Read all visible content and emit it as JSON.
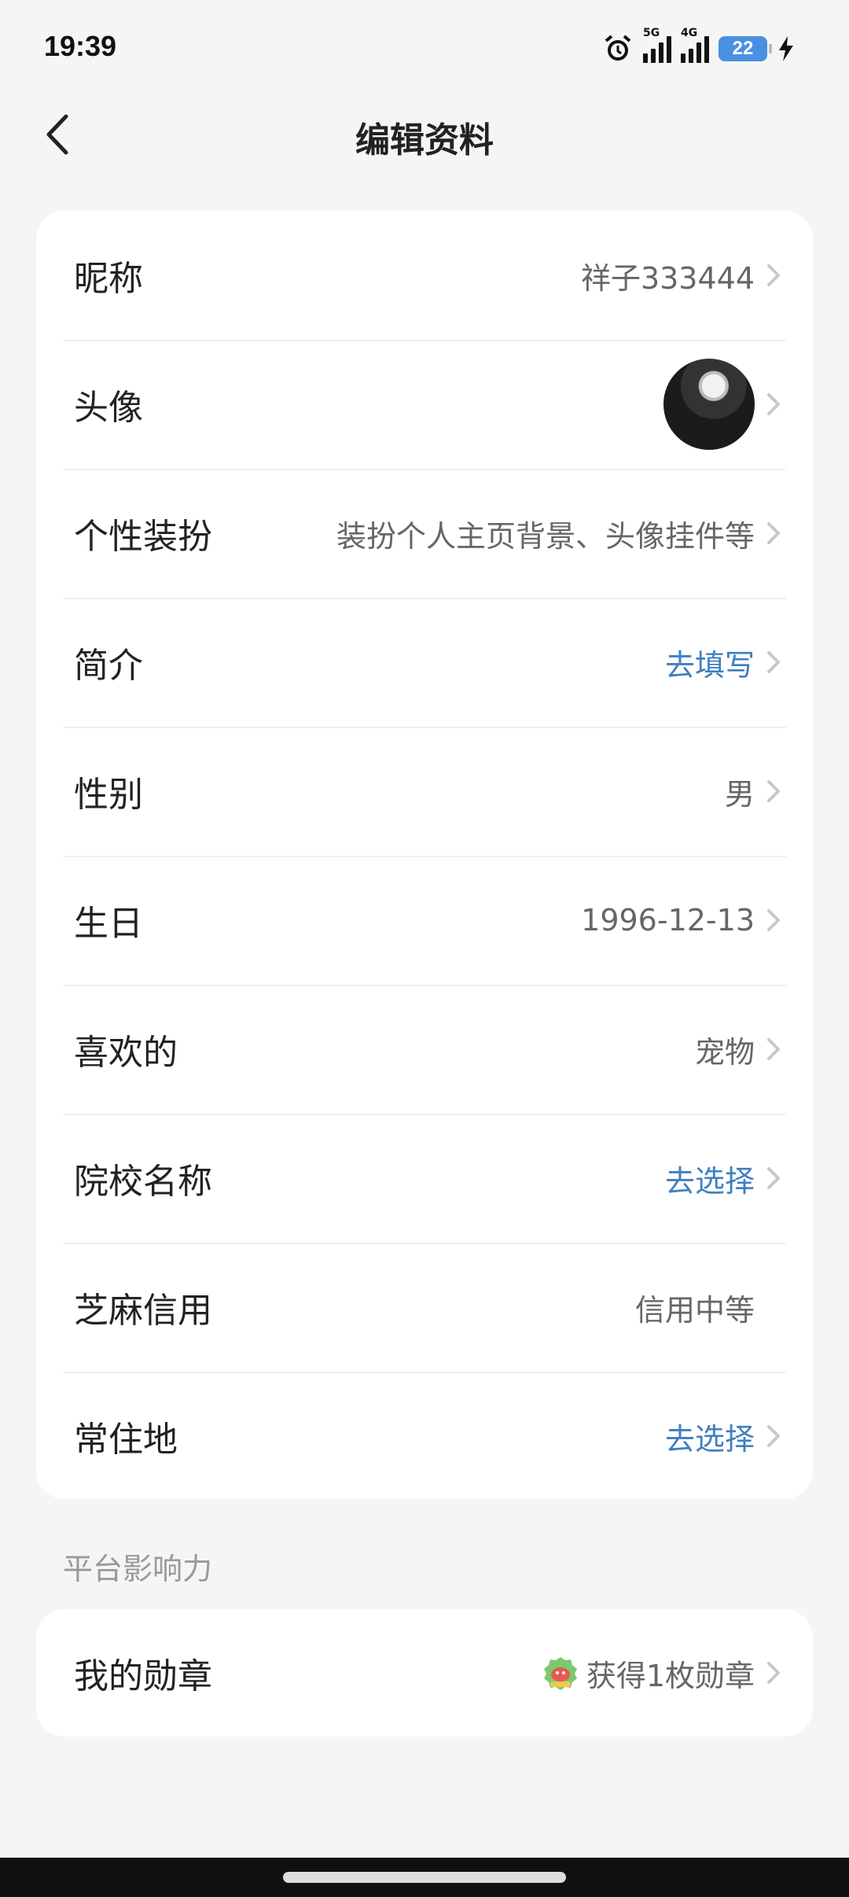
{
  "status_bar": {
    "time": "19:39",
    "network_5g": "5G",
    "network_4g": "4G",
    "battery": "22",
    "icons": [
      "alarm-icon",
      "signal-5g-icon",
      "signal-4g-icon",
      "battery-icon",
      "charging-icon"
    ]
  },
  "header": {
    "title": "编辑资料",
    "back_icon": "back-chevron-icon"
  },
  "profile": {
    "nickname": {
      "label": "昵称",
      "value": "祥子333444"
    },
    "avatar": {
      "label": "头像"
    },
    "dressup": {
      "label": "个性装扮",
      "value": "装扮个人主页背景、头像挂件等"
    },
    "bio": {
      "label": "简介",
      "value": "去填写"
    },
    "gender": {
      "label": "性别",
      "value": "男"
    },
    "birthday": {
      "label": "生日",
      "value": "1996-12-13"
    },
    "likes": {
      "label": "喜欢的",
      "value": "宠物"
    },
    "school": {
      "label": "院校名称",
      "value": "去选择"
    },
    "credit": {
      "label": "芝麻信用",
      "value": "信用中等"
    },
    "residence": {
      "label": "常住地",
      "value": "去选择"
    }
  },
  "influence": {
    "section_title": "平台影响力",
    "badges": {
      "label": "我的勋章",
      "value": "获得1枚勋章",
      "icon": "badge-icon"
    }
  },
  "colors": {
    "background": "#f5f5f5",
    "card": "#ffffff",
    "link_blue": "#3f7fc0",
    "value_gray": "#666666",
    "battery_blue": "#4a90e2"
  }
}
